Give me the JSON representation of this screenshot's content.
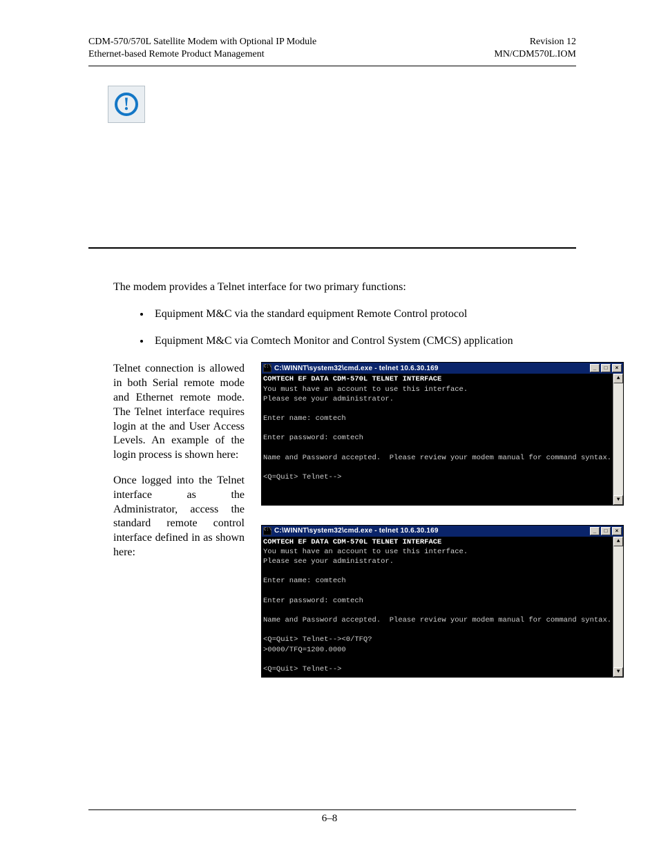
{
  "header": {
    "left1": "CDM-570/570L Satellite Modem with Optional IP Module",
    "left2": "Ethernet-based Remote Product Management",
    "right1": "Revision 12",
    "right2": "MN/CDM570L.IOM"
  },
  "alert_glyph": "!",
  "intro": "The modem provides a Telnet interface for two primary functions:",
  "bullets": [
    "Equipment M&C via the standard equipment Remote Control protocol",
    "Equipment M&C via Comtech Monitor and Control System (CMCS) application"
  ],
  "para1": "Telnet connection is allowed in both Serial remote mode and Ethernet remote mode. The Telnet interface requires login at the and User Access Levels. An example of the login process is shown here:",
  "para2": "Once logged into the Telnet interface as the Administrator, access the standard remote control interface defined in as shown here:",
  "terminal1": {
    "title": "C:\\WINNT\\system32\\cmd.exe - telnet 10.6.30.169",
    "lines": {
      "l1": "COMTECH EF DATA CDM-570L TELNET INTERFACE",
      "l2": "You must have an account to use this interface.",
      "l3": "Please see your administrator.",
      "l4": "Enter name: comtech",
      "l5": "Enter password: comtech",
      "l6": "Name and Password accepted.  Please review your modem manual for command syntax.",
      "l7": "<Q=Quit> Telnet-->"
    }
  },
  "terminal2": {
    "title": "C:\\WINNT\\system32\\cmd.exe - telnet 10.6.30.169",
    "lines": {
      "l1": "COMTECH EF DATA CDM-570L TELNET INTERFACE",
      "l2": "You must have an account to use this interface.",
      "l3": "Please see your administrator.",
      "l4": "Enter name: comtech",
      "l5": "Enter password: comtech",
      "l6": "Name and Password accepted.  Please review your modem manual for command syntax.",
      "l7": "<Q=Quit> Telnet--><0/TFQ?",
      "l8": ">0000/TFQ=1200.0000",
      "l9": "<Q=Quit> Telnet-->"
    }
  },
  "window_controls": {
    "minimize": "_",
    "maximize": "□",
    "close": "×",
    "scroll_up": "▲",
    "scroll_down": "▼"
  },
  "page_number": "6–8"
}
